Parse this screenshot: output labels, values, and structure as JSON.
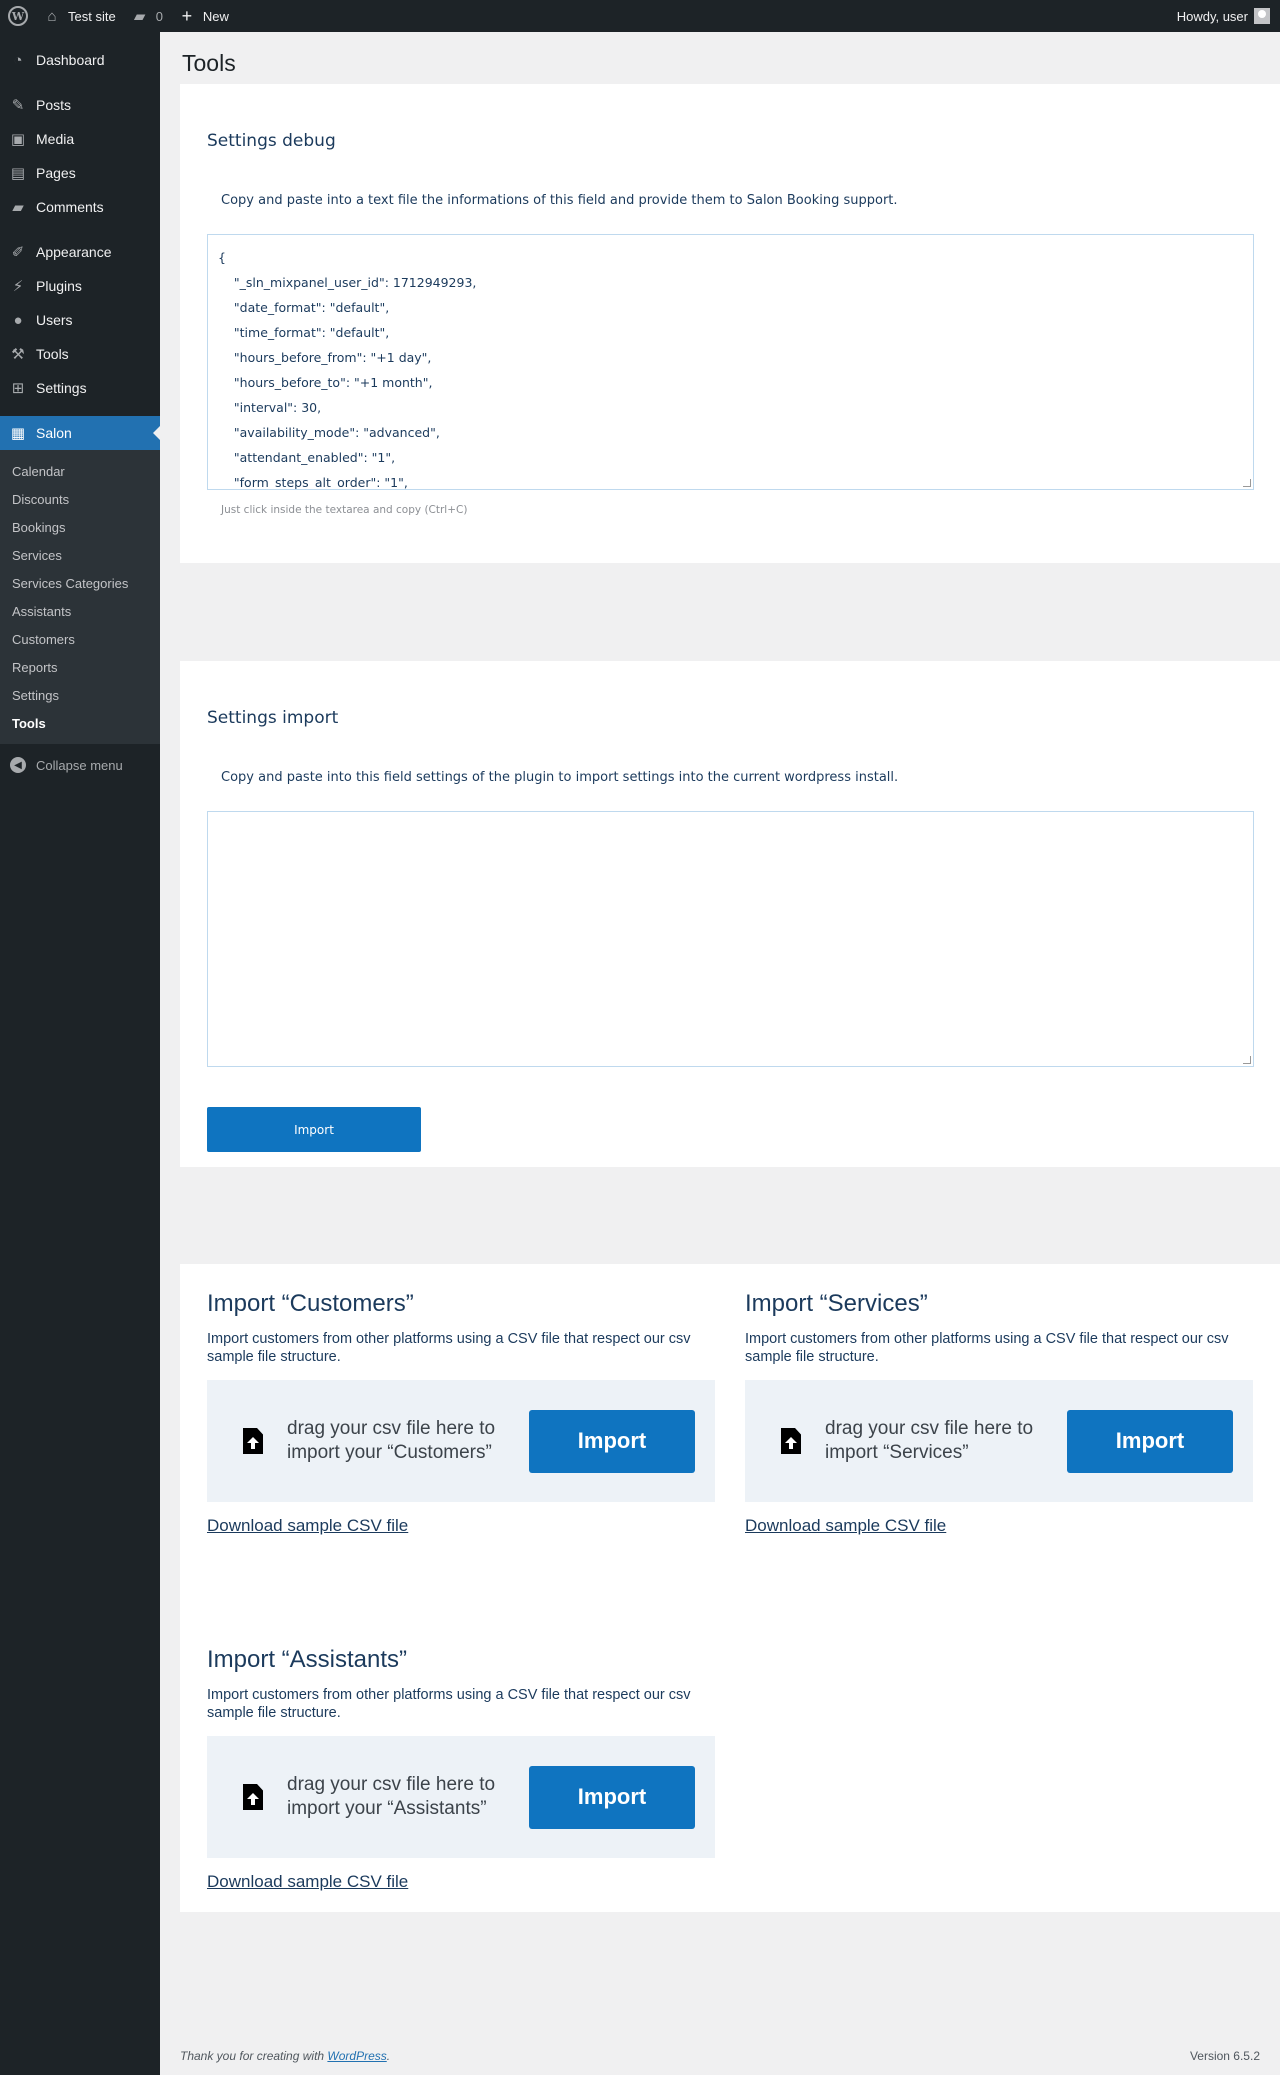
{
  "adminbar": {
    "site_name": "Test site",
    "comments_count": "0",
    "new_label": "New",
    "howdy": "Howdy, user"
  },
  "sidebar": {
    "items": [
      {
        "label": "Dashboard",
        "icon": "dashboard-icon"
      },
      {
        "label": "Posts",
        "icon": "pin-icon"
      },
      {
        "label": "Media",
        "icon": "media-icon"
      },
      {
        "label": "Pages",
        "icon": "pages-icon"
      },
      {
        "label": "Comments",
        "icon": "comment-icon"
      },
      {
        "label": "Appearance",
        "icon": "brush-icon"
      },
      {
        "label": "Plugins",
        "icon": "plugin-icon"
      },
      {
        "label": "Users",
        "icon": "user-icon"
      },
      {
        "label": "Tools",
        "icon": "wrench-icon"
      },
      {
        "label": "Settings",
        "icon": "settings-icon"
      },
      {
        "label": "Salon",
        "icon": "calendar-icon"
      }
    ],
    "submenu": [
      "Calendar",
      "Discounts",
      "Bookings",
      "Services",
      "Services Categories",
      "Assistants",
      "Customers",
      "Reports",
      "Settings",
      "Tools"
    ],
    "collapse_label": "Collapse menu"
  },
  "page": {
    "title": "Tools"
  },
  "debug": {
    "title": "Settings debug",
    "description": "Copy and paste into a text file the informations of this field and provide them to Salon Booking support.",
    "lines": [
      "{",
      "    \"_sln_mixpanel_user_id\": 1712949293,",
      "    \"date_format\": \"default\",",
      "    \"time_format\": \"default\",",
      "    \"hours_before_from\": \"+1 day\",",
      "    \"hours_before_to\": \"+1 month\",",
      "    \"interval\": 30,",
      "    \"availability_mode\": \"advanced\",",
      "    \"attendant_enabled\": \"1\",",
      "    \"form_steps_alt_order\": \"1\","
    ],
    "hint": "Just click inside the textarea and copy (Ctrl+C)"
  },
  "import_settings": {
    "title": "Settings import",
    "description": "Copy and paste into this field settings of the plugin to import settings into the current wordpress install.",
    "button": "Import"
  },
  "imports": [
    {
      "title": "Import “Customers”",
      "description": "Import customers from other platforms using a CSV file that respect our csv sample file structure.",
      "drop_text": "drag your csv file here to import your “Customers”",
      "button": "Import",
      "link": "Download sample CSV file"
    },
    {
      "title": "Import “Services”",
      "description": "Import customers from other platforms using a CSV file that respect our csv sample file structure.",
      "drop_text": "drag your csv file here to import “Services”",
      "button": "Import",
      "link": "Download sample CSV file"
    },
    {
      "title": "Import “Assistants”",
      "description": "Import customers from other platforms using a CSV file that respect our csv sample file structure.",
      "drop_text": "drag your csv file here to import your “Assistants”",
      "button": "Import",
      "link": "Download sample CSV file"
    }
  ],
  "footer": {
    "thanks_prefix": "Thank you for creating with ",
    "thanks_link": "WordPress",
    "thanks_suffix": ".",
    "version": "Version 6.5.2"
  }
}
